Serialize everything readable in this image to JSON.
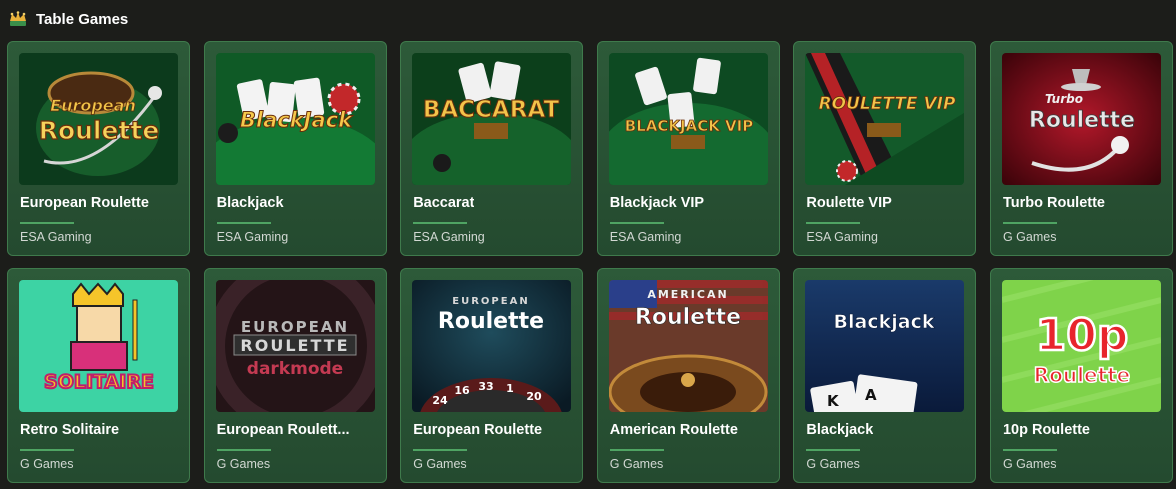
{
  "section": {
    "title": "Table Games",
    "icon": "crown-icon"
  },
  "games": [
    {
      "title": "European Roulette",
      "provider": "ESA Gaming",
      "art": [
        "European",
        "Roulette"
      ]
    },
    {
      "title": "Blackjack",
      "provider": "ESA Gaming",
      "art": [
        "BlackJack"
      ]
    },
    {
      "title": "Baccarat",
      "provider": "ESA Gaming",
      "art": [
        "BACCARAT"
      ]
    },
    {
      "title": "Blackjack VIP",
      "provider": "ESA Gaming",
      "art": [
        "BLACKJACK VIP"
      ]
    },
    {
      "title": "Roulette VIP",
      "provider": "ESA Gaming",
      "art": [
        "ROULETTE VIP"
      ]
    },
    {
      "title": "Turbo Roulette",
      "provider": "G Games",
      "art": [
        "Turbo",
        "Roulette"
      ]
    },
    {
      "title": "Retro Solitaire",
      "provider": "G Games",
      "art": [
        "SOLITAIRE"
      ]
    },
    {
      "title": "European Roulett...",
      "provider": "G Games",
      "art": [
        "EUROPEAN",
        "ROULETTE",
        "darkmode"
      ]
    },
    {
      "title": "European Roulette",
      "provider": "G Games",
      "art": [
        "EUROPEAN",
        "Roulette",
        "24",
        "16",
        "33",
        "1",
        "20"
      ]
    },
    {
      "title": "American Roulette",
      "provider": "G Games",
      "art": [
        "AMERICAN",
        "Roulette"
      ]
    },
    {
      "title": "Blackjack",
      "provider": "G Games",
      "art": [
        "Blackjack",
        "K",
        "A"
      ]
    },
    {
      "title": "10p Roulette",
      "provider": "G Games",
      "art": [
        "10p",
        "Roulette"
      ]
    }
  ]
}
